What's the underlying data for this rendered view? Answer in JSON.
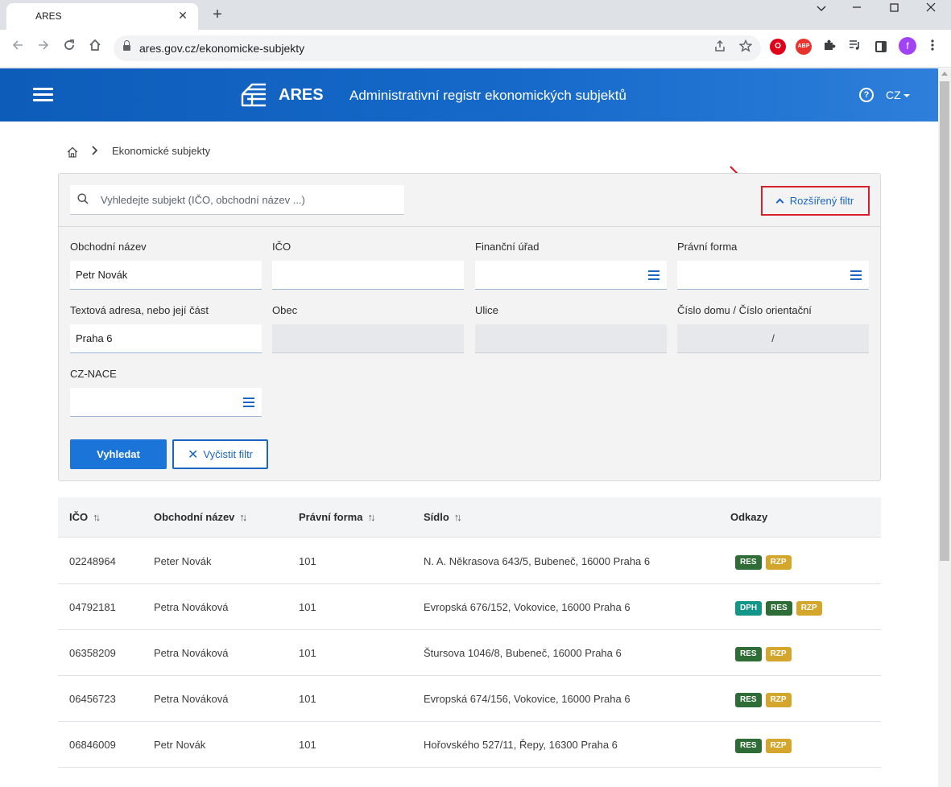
{
  "browser": {
    "tab_title": "ARES",
    "tab_close": "✕",
    "new_tab": "+",
    "url": "ares.gov.cz/ekonomicke-subjekty",
    "profile_initial": "f",
    "ext_opera": "O",
    "ext_abp": "ABP",
    "window_controls": {
      "minimize": "⌄",
      "maximize": "☐",
      "close": "✕"
    }
  },
  "header": {
    "logo_text": "ARES",
    "title": "Administrativní registr ekonomických subjektů",
    "help": "?",
    "language": "CZ"
  },
  "breadcrumb": {
    "separator": ">",
    "current": "Ekonomické subjekty"
  },
  "search": {
    "placeholder": "Vyhledejte subjekt (IČO, obchodní název ...)",
    "value": "",
    "advanced_filter_label": "Rozšířený filtr"
  },
  "filter": {
    "fields": [
      {
        "label": "Obchodní název",
        "value": "Petr Novák"
      },
      {
        "label": "IČO",
        "value": ""
      },
      {
        "label": "Finanční úřad",
        "value": ""
      },
      {
        "label": "Právní forma",
        "value": ""
      },
      {
        "label": "Textová adresa, nebo její část",
        "value": "Praha 6"
      },
      {
        "label": "Obec",
        "value": ""
      },
      {
        "label": "Ulice",
        "value": ""
      },
      {
        "label": "Číslo domu / Číslo orientační",
        "value": "/"
      },
      {
        "label": "CZ-NACE",
        "value": ""
      }
    ],
    "search_button": "Vyhledat",
    "clear_button": "Vyčistit filtr",
    "clear_icon": "✕"
  },
  "table": {
    "columns": [
      "IČO",
      "Obchodní název",
      "Právní forma",
      "Sídlo",
      "Odkazy"
    ],
    "sort_icon": "↑↓",
    "rows": [
      {
        "ico": "02248964",
        "name": "Peter Novák",
        "form": "101",
        "address": "N. A. Někrasova 643/5, Bubeneč, 16000 Praha 6",
        "links": [
          "RES",
          "RZP"
        ]
      },
      {
        "ico": "04792181",
        "name": "Petra Nováková",
        "form": "101",
        "address": "Evropská 676/152, Vokovice, 16000 Praha 6",
        "links": [
          "DPH",
          "RES",
          "RZP"
        ]
      },
      {
        "ico": "06358209",
        "name": "Petra Nováková",
        "form": "101",
        "address": "Štursova 1046/8, Bubeneč, 16000 Praha 6",
        "links": [
          "RES",
          "RZP"
        ]
      },
      {
        "ico": "06456723",
        "name": "Petra Nováková",
        "form": "101",
        "address": "Evropská 674/156, Vokovice, 16000 Praha 6",
        "links": [
          "RES",
          "RZP"
        ]
      },
      {
        "ico": "06846009",
        "name": "Petr Novák",
        "form": "101",
        "address": "Hořovského 527/11, Řepy, 16300 Praha 6",
        "links": [
          "RES",
          "RZP"
        ]
      }
    ]
  },
  "colors": {
    "header_blue": "#0d5cba",
    "primary_button": "#1b74d8",
    "annotation_red": "#d6202b",
    "badge_RES": "#2e6e36",
    "badge_RZP": "#d4a72c",
    "badge_DPH": "#13968a"
  }
}
